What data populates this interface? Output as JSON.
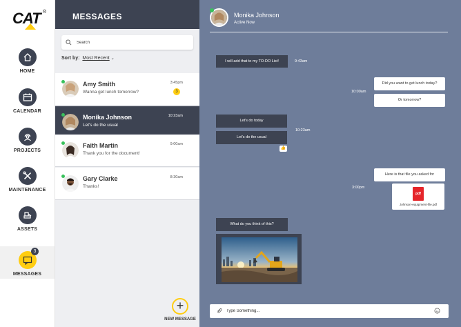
{
  "brand": {
    "logo_text": "CAT",
    "registered": "®"
  },
  "nav": {
    "items": [
      {
        "label": "HOME",
        "icon": "home-icon"
      },
      {
        "label": "CALENDAR",
        "icon": "calendar-icon"
      },
      {
        "label": "PROJECTS",
        "icon": "worker-icon"
      },
      {
        "label": "MAINTENANCE",
        "icon": "tools-icon"
      },
      {
        "label": "ASSETS",
        "icon": "equipment-icon"
      },
      {
        "label": "MESSAGES",
        "icon": "chat-icon",
        "badge": "3",
        "active": true
      }
    ]
  },
  "messages_panel": {
    "title": "MESSAGES",
    "search_placeholder": "Search",
    "sort_label": "Sort by:",
    "sort_value": "Most Recent",
    "conversations": [
      {
        "name": "Amy Smith",
        "preview": "Wanna get lunch tomorrow?",
        "time": "3:45pm",
        "unread": "3",
        "online": true
      },
      {
        "name": "Monika Johnson",
        "preview": "Let's do the usual",
        "time": "10:23am",
        "online": true,
        "selected": true
      },
      {
        "name": "Faith Martin",
        "preview": "Thank you for the document!",
        "time": "9:00am",
        "online": true
      },
      {
        "name": "Gary Clarke",
        "preview": "Thanks!",
        "time": "8:30am",
        "online": true
      }
    ],
    "new_message_label": "NEW MESSAGE"
  },
  "chat": {
    "contact_name": "Monika Johnson",
    "contact_status": "Active Now",
    "messages": [
      {
        "text": "I will add that to my TO-DO List!",
        "dir": "in"
      },
      {
        "text": "Did you want to get lunch today?",
        "dir": "out"
      },
      {
        "text": "Or tomorrow?",
        "dir": "out"
      },
      {
        "text": "Let's do today",
        "dir": "in"
      },
      {
        "text": "Let's do the usual",
        "dir": "in"
      },
      {
        "text": "Here is that file you asked for",
        "dir": "out"
      },
      {
        "text": "What do you think of this?",
        "dir": "in"
      }
    ],
    "timestamps": [
      "9:43am",
      "10:00am",
      "10:23am",
      "3:00pm"
    ],
    "reaction": "👍",
    "file": {
      "type_label": "pdf",
      "name": "Johnson-equipment-file.pdf"
    },
    "composer_placeholder": "Type Something..."
  },
  "colors": {
    "accent": "#ffcd11",
    "dark": "#3d4352",
    "chat_bg": "#6e7d9a",
    "online": "#39c15b"
  }
}
